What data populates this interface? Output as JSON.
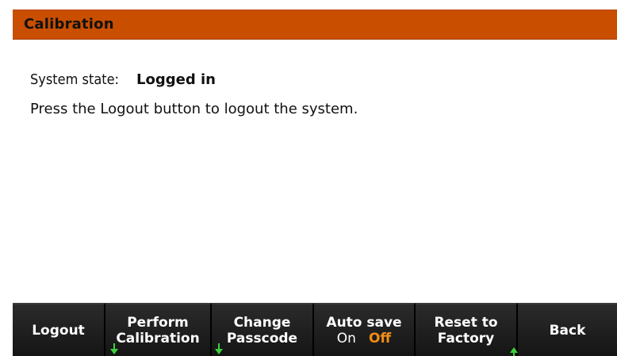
{
  "header": {
    "title": "Calibration"
  },
  "content": {
    "system_state_label": "System state:",
    "system_state_value": "Logged in",
    "instruction": "Press the Logout button to logout the system."
  },
  "softkeys": {
    "logout": "Logout",
    "perform_line1": "Perform",
    "perform_line2": "Calibration",
    "change_line1": "Change",
    "change_line2": "Passcode",
    "auto_save_line1": "Auto save",
    "auto_save_on": "On",
    "auto_save_off": "Off",
    "auto_save_selected": "Off",
    "reset_line1": "Reset to",
    "reset_line2": "Factory",
    "back": "Back"
  },
  "colors": {
    "title_bar": "#c94e00",
    "softkey_bg": "#1d1d1d",
    "selected_option": "#f28c14",
    "submenu_arrow": "#3cd13c"
  },
  "icons": {
    "perform_calibration_indicator": "arrow-down-icon",
    "change_passcode_indicator": "arrow-down-icon",
    "reset_to_factory_indicator": "arrow-up-icon"
  }
}
